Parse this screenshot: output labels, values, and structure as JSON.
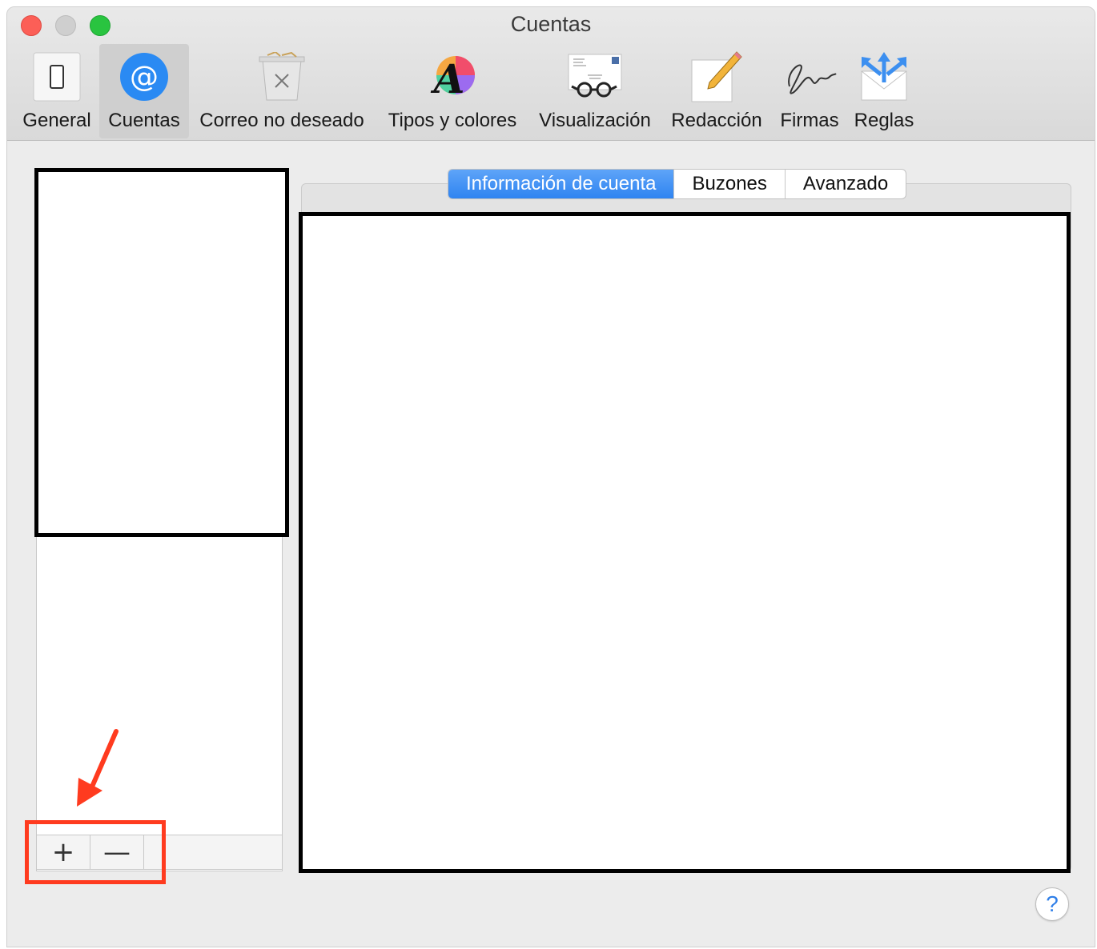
{
  "window": {
    "title": "Cuentas"
  },
  "toolbar": {
    "items": [
      {
        "label": "General",
        "icon": "switch-icon"
      },
      {
        "label": "Cuentas",
        "icon": "at-sign-icon",
        "selected": true
      },
      {
        "label": "Correo no deseado",
        "icon": "trash-can-icon"
      },
      {
        "label": "Tipos y colores",
        "icon": "font-color-wheel-icon"
      },
      {
        "label": "Visualización",
        "icon": "envelope-glasses-icon"
      },
      {
        "label": "Redacción",
        "icon": "pencil-paper-icon"
      },
      {
        "label": "Firmas",
        "icon": "signature-icon"
      },
      {
        "label": "Reglas",
        "icon": "envelope-arrows-icon"
      }
    ]
  },
  "tabs": [
    {
      "label": "Información de cuenta",
      "active": true
    },
    {
      "label": "Buzones",
      "active": false
    },
    {
      "label": "Avanzado",
      "active": false
    }
  ],
  "list_footer": {
    "add_label": "+",
    "remove_label": "—"
  },
  "help": {
    "label": "?"
  },
  "colors": {
    "accent": "#2f84f1",
    "annotation": "#ff3b1f"
  }
}
